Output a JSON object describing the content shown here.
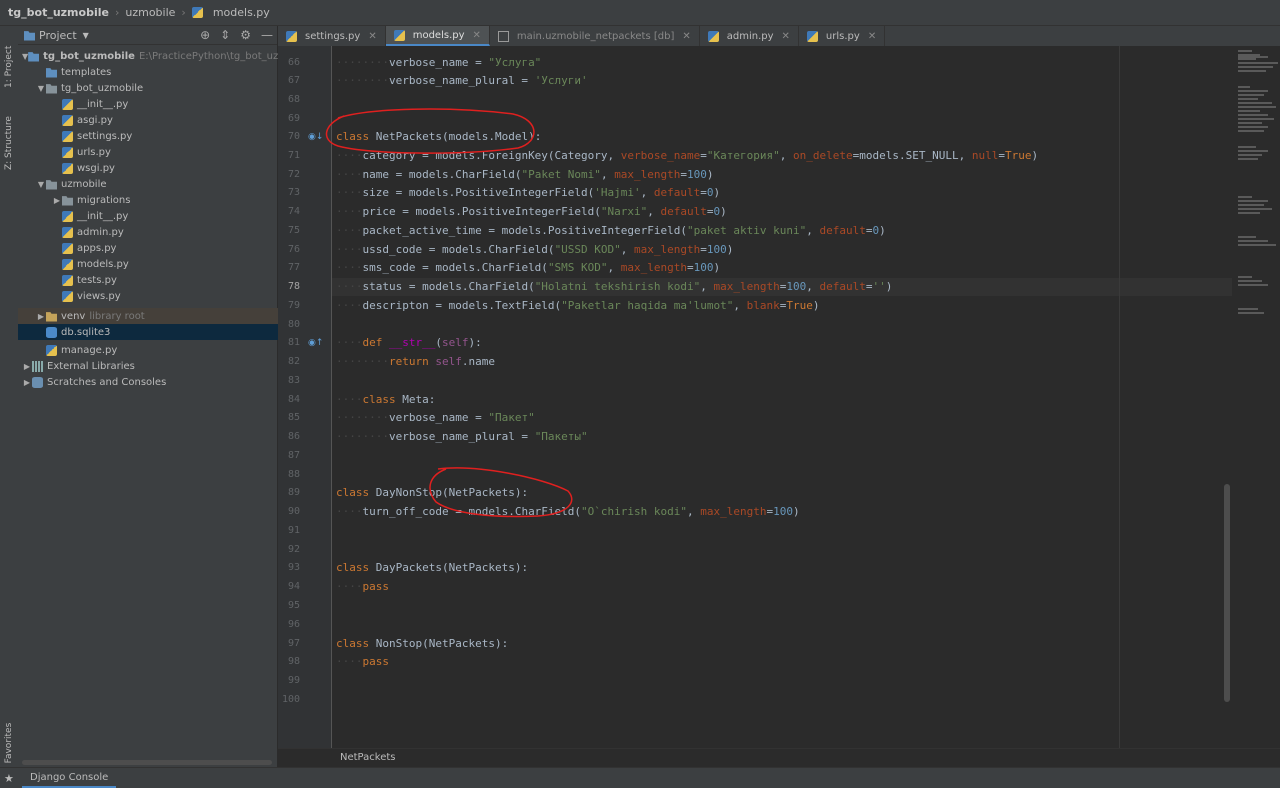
{
  "breadcrumb": {
    "project": "tg_bot_uzmobile",
    "module": "uzmobile",
    "file": "models.py"
  },
  "left_strip": {
    "project_tab": "1: Project",
    "structure_tab": "Z: Structure",
    "favorites_tab": "2: Favorites"
  },
  "project_panel": {
    "title": "Project",
    "root_name": "tg_bot_uzmobile",
    "root_path": "E:\\PracticePython\\tg_bot_uzmobile",
    "items": [
      {
        "label": "templates",
        "note": ""
      },
      {
        "label": "tg_bot_uzmobile",
        "note": ""
      },
      {
        "label": "__init__.py",
        "note": ""
      },
      {
        "label": "asgi.py",
        "note": ""
      },
      {
        "label": "settings.py",
        "note": ""
      },
      {
        "label": "urls.py",
        "note": ""
      },
      {
        "label": "wsgi.py",
        "note": ""
      },
      {
        "label": "uzmobile",
        "note": ""
      },
      {
        "label": "migrations",
        "note": ""
      },
      {
        "label": "__init__.py",
        "note": ""
      },
      {
        "label": "admin.py",
        "note": ""
      },
      {
        "label": "apps.py",
        "note": ""
      },
      {
        "label": "models.py",
        "note": ""
      },
      {
        "label": "tests.py",
        "note": ""
      },
      {
        "label": "views.py",
        "note": ""
      },
      {
        "label": "venv",
        "note": "library root"
      },
      {
        "label": "db.sqlite3",
        "note": ""
      },
      {
        "label": "manage.py",
        "note": ""
      },
      {
        "label": "External Libraries",
        "note": ""
      },
      {
        "label": "Scratches and Consoles",
        "note": ""
      }
    ]
  },
  "tabs": [
    {
      "label": "settings.py"
    },
    {
      "label": "models.py"
    },
    {
      "label": "main.uzmobile_netpackets [db]"
    },
    {
      "label": "admin.py"
    },
    {
      "label": "urls.py"
    }
  ],
  "editor": {
    "line_numbers": [
      "66",
      "67",
      "68",
      "69",
      "70",
      "71",
      "72",
      "73",
      "74",
      "75",
      "76",
      "77",
      "78",
      "79",
      "80",
      "81",
      "82",
      "83",
      "84",
      "85",
      "86",
      "87",
      "88",
      "89",
      "90",
      "91",
      "92",
      "93",
      "94",
      "95",
      "96",
      "97",
      "98",
      "99",
      "100"
    ],
    "current_line": "78",
    "code": {
      "l66_a": "verbose_name = ",
      "l66_s": "\"Услуга\"",
      "l67_a": "verbose_name_plural = ",
      "l67_s": "'Услуги'",
      "l70_kw": "class ",
      "l70_rest": "NetPackets(models.Model):",
      "l71_a": "category = models.ForeignKey(Category, ",
      "l71_arg1": "verbose_name",
      "l71_eq": "=",
      "l71_s": "\"Категория\"",
      "l71_b": ", ",
      "l71_arg2": "on_delete",
      "l71_c": "=models.SET_NULL, ",
      "l71_arg3": "null",
      "l71_d": "=",
      "l71_kw": "True",
      "l71_e": ")",
      "l72_a": "name = models.CharField(",
      "l72_s": "\"Paket Nomi\"",
      "l72_b": ", ",
      "l72_arg": "max_length",
      "l72_c": "=",
      "l72_n": "100",
      "l72_d": ")",
      "l73_a": "size = models.PositiveIntegerField(",
      "l73_s": "'Hajmi'",
      "l73_b": ", ",
      "l73_arg": "default",
      "l73_c": "=",
      "l73_n": "0",
      "l73_d": ")",
      "l74_a": "price = models.PositiveIntegerField(",
      "l74_s": "\"Narxi\"",
      "l74_b": ", ",
      "l74_arg": "default",
      "l74_c": "=",
      "l74_n": "0",
      "l74_d": ")",
      "l75_a": "packet_active_time = models.PositiveIntegerField(",
      "l75_s": "\"paket aktiv kuni\"",
      "l75_b": ", ",
      "l75_arg": "default",
      "l75_c": "=",
      "l75_n": "0",
      "l75_d": ")",
      "l76_a": "ussd_code = models.CharField(",
      "l76_s": "\"USSD KOD\"",
      "l76_b": ", ",
      "l76_arg": "max_length",
      "l76_c": "=",
      "l76_n": "100",
      "l76_d": ")",
      "l77_a": "sms_code = models.CharField(",
      "l77_s": "\"SMS KOD\"",
      "l77_b": ", ",
      "l77_arg": "max_length",
      "l77_c": "=",
      "l77_n": "100",
      "l77_d": ")",
      "l78_a": "status = models.CharField(",
      "l78_s": "\"Holatni tekshirish kodi\"",
      "l78_b": ", ",
      "l78_arg1": "max_length",
      "l78_c": "=",
      "l78_n": "100",
      "l78_d": ", ",
      "l78_arg2": "default",
      "l78_e": "=",
      "l78_s2": "''",
      "l78_f": ")",
      "l79_a": "descripton = models.TextField(",
      "l79_s": "\"Paketlar haqida ma'lumot\"",
      "l79_b": ", ",
      "l79_arg": "blank",
      "l79_c": "=",
      "l79_kw": "True",
      "l79_d": ")",
      "l81_kw": "def ",
      "l81_fn": "__str__",
      "l81_a": "(",
      "l81_self": "self",
      "l81_b": "):",
      "l82_kw": "return ",
      "l82_self": "self",
      "l82_a": ".name",
      "l84_kw": "class ",
      "l84_rest": "Meta:",
      "l85_a": "verbose_name = ",
      "l85_s": "\"Пакет\"",
      "l86_a": "verbose_name_plural = ",
      "l86_s": "\"Пакеты\"",
      "l89_kw": "class ",
      "l89_rest": "DayNonStop(NetPackets):",
      "l90_a": "turn_off_code = models.CharField(",
      "l90_s": "\"O`chirish kodi\"",
      "l90_b": ", ",
      "l90_arg": "max_length",
      "l90_c": "=",
      "l90_n": "100",
      "l90_d": ")",
      "l93_kw": "class ",
      "l93_rest": "DayPackets(NetPackets):",
      "l94_kw": "pass",
      "l97_kw": "class ",
      "l97_rest": "NonStop(NetPackets):",
      "l98_kw": "pass"
    }
  },
  "breadcrumb_bar": {
    "text": "NetPackets"
  },
  "bottom": {
    "console_tab": "Django Console"
  },
  "colors": {
    "keyword": "#cc7832",
    "string": "#6a8759",
    "number": "#6897bb",
    "argument": "#aa4926",
    "annotation": "#e0201f"
  },
  "icons": {
    "settings": "gear-icon",
    "collapse": "collapse-icon",
    "hide": "minimize-icon",
    "locate": "target-icon"
  }
}
